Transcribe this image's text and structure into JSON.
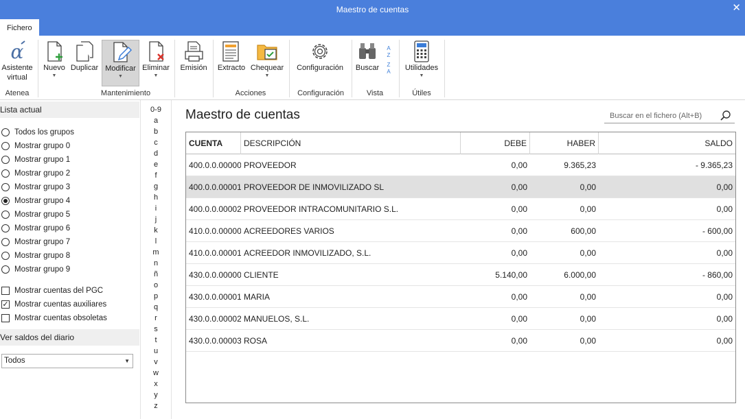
{
  "window": {
    "title": "Maestro de cuentas",
    "close_glyph": "✕"
  },
  "menu": {
    "file_tab": "Fichero"
  },
  "ribbon": {
    "buttons": {
      "asistente": {
        "label1": "Asistente",
        "label2": "virtual",
        "icon": "alpha-icon"
      },
      "nuevo": {
        "label": "Nuevo",
        "icon": "new-document-icon"
      },
      "duplicar": {
        "label": "Duplicar",
        "icon": "duplicate-icon"
      },
      "modificar": {
        "label": "Modificar",
        "icon": "edit-document-icon"
      },
      "eliminar": {
        "label": "Eliminar",
        "icon": "delete-document-icon"
      },
      "emision": {
        "label": "Emisión",
        "icon": "print-icon"
      },
      "extracto": {
        "label": "Extracto",
        "icon": "statement-icon"
      },
      "chequear": {
        "label": "Chequear",
        "icon": "check-folder-icon"
      },
      "configuracion": {
        "label": "Configuración",
        "icon": "gear-icon"
      },
      "buscar": {
        "label": "Buscar",
        "icon": "binoculars-icon"
      },
      "utilidades": {
        "label": "Utilidades",
        "icon": "calculator-icon"
      }
    },
    "groups": {
      "atenea": "Atenea",
      "mantenimiento": "Mantenimiento",
      "acciones": "Acciones",
      "configuracion": "Configuración",
      "vista": "Vista",
      "utiles": "Útiles"
    },
    "sort_az": "A Z",
    "sort_za": "Z A"
  },
  "sidebar": {
    "list_header": "Lista actual",
    "groups": [
      {
        "label": "Todos los grupos",
        "selected": false
      },
      {
        "label": "Mostrar grupo 0",
        "selected": false
      },
      {
        "label": "Mostrar grupo 1",
        "selected": false
      },
      {
        "label": "Mostrar grupo 2",
        "selected": false
      },
      {
        "label": "Mostrar grupo 3",
        "selected": false
      },
      {
        "label": "Mostrar grupo 4",
        "selected": true
      },
      {
        "label": "Mostrar grupo 5",
        "selected": false
      },
      {
        "label": "Mostrar grupo 6",
        "selected": false
      },
      {
        "label": "Mostrar grupo 7",
        "selected": false
      },
      {
        "label": "Mostrar grupo 8",
        "selected": false
      },
      {
        "label": "Mostrar grupo 9",
        "selected": false
      }
    ],
    "checks": [
      {
        "label": "Mostrar cuentas del PGC",
        "checked": false
      },
      {
        "label": "Mostrar cuentas auxiliares",
        "checked": true
      },
      {
        "label": "Mostrar cuentas obsoletas",
        "checked": false
      }
    ],
    "saldos_header": "Ver saldos del diario",
    "saldos_value": "Todos"
  },
  "alphabet": [
    "0-9",
    "a",
    "b",
    "c",
    "d",
    "e",
    "f",
    "g",
    "h",
    "i",
    "j",
    "k",
    "l",
    "m",
    "n",
    "ñ",
    "o",
    "p",
    "q",
    "r",
    "s",
    "t",
    "u",
    "v",
    "w",
    "x",
    "y",
    "z"
  ],
  "main": {
    "title": "Maestro de cuentas",
    "search_placeholder": "Buscar en el fichero (Alt+B)"
  },
  "table": {
    "headers": {
      "cuenta": "CUENTA",
      "descripcion": "DESCRIPCIÓN",
      "debe": "DEBE",
      "haber": "HABER",
      "saldo": "SALDO"
    },
    "rows": [
      {
        "cuenta": "400.0.0.00000",
        "descripcion": "PROVEEDOR",
        "debe": "0,00",
        "haber": "9.365,23",
        "saldo": "- 9.365,23",
        "selected": false
      },
      {
        "cuenta": "400.0.0.00001",
        "descripcion": "PROVEEDOR DE INMOVILIZADO SL",
        "debe": "0,00",
        "haber": "0,00",
        "saldo": "0,00",
        "selected": true
      },
      {
        "cuenta": "400.0.0.00002",
        "descripcion": "PROVEEDOR INTRACOMUNITARIO S.L.",
        "debe": "0,00",
        "haber": "0,00",
        "saldo": "0,00",
        "selected": false
      },
      {
        "cuenta": "410.0.0.00000",
        "descripcion": "ACREEDORES VARIOS",
        "debe": "0,00",
        "haber": "600,00",
        "saldo": "- 600,00",
        "selected": false
      },
      {
        "cuenta": "410.0.0.00001",
        "descripcion": "ACREEDOR INMOVILIZADO, S.L.",
        "debe": "0,00",
        "haber": "0,00",
        "saldo": "0,00",
        "selected": false
      },
      {
        "cuenta": "430.0.0.00000",
        "descripcion": "CLIENTE",
        "debe": "5.140,00",
        "haber": "6.000,00",
        "saldo": "- 860,00",
        "selected": false
      },
      {
        "cuenta": "430.0.0.00001",
        "descripcion": "MARIA",
        "debe": "0,00",
        "haber": "0,00",
        "saldo": "0,00",
        "selected": false
      },
      {
        "cuenta": "430.0.0.00002",
        "descripcion": "MANUELOS, S.L.",
        "debe": "0,00",
        "haber": "0,00",
        "saldo": "0,00",
        "selected": false
      },
      {
        "cuenta": "430.0.0.00003",
        "descripcion": "ROSA",
        "debe": "0,00",
        "haber": "0,00",
        "saldo": "0,00",
        "selected": false
      }
    ]
  }
}
